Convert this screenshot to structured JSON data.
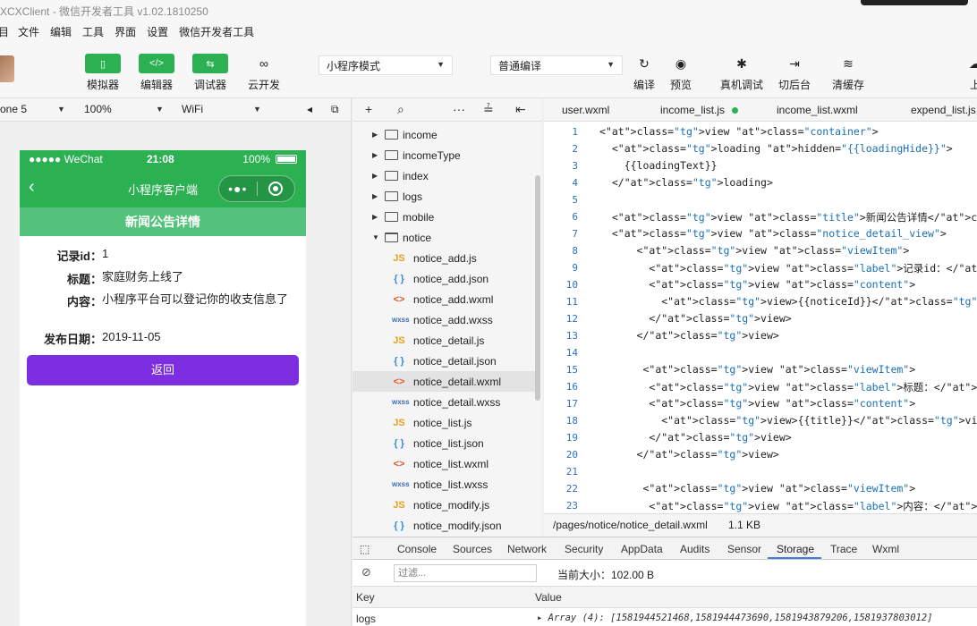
{
  "window": {
    "title": "XCXClient - 微信开发者工具 v1.02.1810250"
  },
  "menu": {
    "items": [
      "目",
      "文件",
      "编辑",
      "工具",
      "界面",
      "设置",
      "微信开发者工具"
    ]
  },
  "toolbar": {
    "simulator": "模拟器",
    "editor": "编辑器",
    "debugger": "调试器",
    "cloud": "云开发",
    "mode_select": "小程序模式",
    "compile_select": "普通编译",
    "compile": "编译",
    "preview": "预览",
    "real_debug": "真机调试",
    "background": "切后台",
    "clear_cache": "清缓存",
    "upload": "上"
  },
  "devbar": {
    "device": "one 5",
    "zoom": "100%",
    "network": "WiFi"
  },
  "phone": {
    "status_left": "●●●●● WeChat",
    "time": "21:08",
    "battery": "100%",
    "nav_title": "小程序客户端",
    "page_title": "新闻公告详情",
    "fields": [
      {
        "label": "记录id：",
        "value": "1"
      },
      {
        "label": "标题：",
        "value": "家庭财务上线了"
      },
      {
        "label": "内容：",
        "value": "小程序平台可以登记你的收支信息了"
      },
      {
        "label": "发布日期：",
        "value": "2019-11-05"
      }
    ],
    "back_button": "返回"
  },
  "tree": {
    "folders": [
      "income",
      "incomeType",
      "index",
      "logs",
      "mobile",
      "notice"
    ],
    "files": [
      {
        "icon": "JS",
        "name": "notice_add.js"
      },
      {
        "icon": "{ }",
        "name": "notice_add.json"
      },
      {
        "icon": "<>",
        "name": "notice_add.wxml"
      },
      {
        "icon": "wxss",
        "name": "notice_add.wxss"
      },
      {
        "icon": "JS",
        "name": "notice_detail.js"
      },
      {
        "icon": "{ }",
        "name": "notice_detail.json"
      },
      {
        "icon": "<>",
        "name": "notice_detail.wxml"
      },
      {
        "icon": "wxss",
        "name": "notice_detail.wxss"
      },
      {
        "icon": "JS",
        "name": "notice_list.js"
      },
      {
        "icon": "{ }",
        "name": "notice_list.json"
      },
      {
        "icon": "<>",
        "name": "notice_list.wxml"
      },
      {
        "icon": "wxss",
        "name": "notice_list.wxss"
      },
      {
        "icon": "JS",
        "name": "notice_modify.js"
      },
      {
        "icon": "{ }",
        "name": "notice_modify.json"
      }
    ]
  },
  "tabs": [
    "user.wxml",
    "income_list.js",
    "income_list.wxml",
    "expend_list.js"
  ],
  "code": {
    "line_numbers": [
      "1",
      "2",
      "3",
      "4",
      "5",
      "6",
      "7",
      "8",
      "9",
      "10",
      "11",
      "12",
      "13",
      "14",
      "15",
      "16",
      "17",
      "18",
      "19",
      "20",
      "21",
      "22",
      "23"
    ],
    "lines": [
      "<view class=\"container\">",
      "  <loading hidden=\"{{loadingHide}}\">",
      "    {{loadingText}}",
      "  </loading>",
      "",
      "  <view class=\"title\">新闻公告详情</view>",
      "  <view class=\"notice_detail_view\">",
      "      <view class=\"viewItem\">",
      "        <view class=\"label\">记录id：</view>",
      "        <view class=\"content\">",
      "          <view>{{noticeId}}</view>",
      "        </view>",
      "      </view>",
      "",
      "       <view class=\"viewItem\">",
      "        <view class=\"label\">标题：</view>",
      "        <view class=\"content\">",
      "          <view>{{title}}</view>",
      "        </view>",
      "      </view>",
      "",
      "       <view class=\"viewItem\">",
      "        <view class=\"label\">内容：</view>"
    ]
  },
  "statusline": {
    "path": "/pages/notice/notice_detail.wxml",
    "size": "1.1 KB"
  },
  "devtools": {
    "tabs": [
      "Console",
      "Sources",
      "Network",
      "Security",
      "AppData",
      "Audits",
      "Sensor",
      "Storage",
      "Trace",
      "Wxml"
    ],
    "filter_placeholder": "过滤...",
    "current_size": "当前大小：102.00 B",
    "key_header": "Key",
    "value_header": "Value",
    "row_key": "logs",
    "row_value": "▸ Array (4): [1581944521468,1581944473690,1581943879206,1581937803012]"
  }
}
